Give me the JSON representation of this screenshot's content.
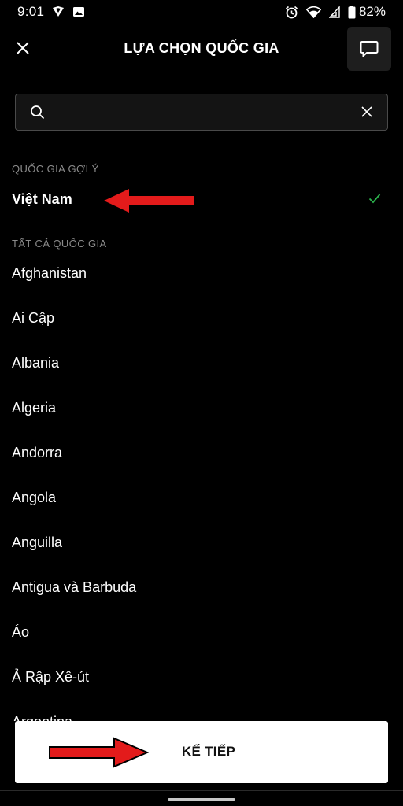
{
  "status_bar": {
    "time": "9:01",
    "battery": "82%",
    "left_icons": [
      "shield-icon",
      "image-icon"
    ],
    "right_icons": [
      "alarm-icon",
      "wifi-icon",
      "signal-icon",
      "battery-icon"
    ]
  },
  "header": {
    "title": "LỰA CHỌN QUỐC GIA",
    "close_icon": "close-icon",
    "chat_icon": "chat-bubble-icon"
  },
  "search": {
    "value": "",
    "placeholder": ""
  },
  "suggested": {
    "header": "QUỐC GIA GỢI Ý",
    "country": "Việt Nam",
    "selected": true
  },
  "all": {
    "header": "TẤT CẢ QUỐC GIA",
    "countries": [
      "Afghanistan",
      "Ai Cập",
      "Albania",
      "Algeria",
      "Andorra",
      "Angola",
      "Anguilla",
      "Antigua và Barbuda",
      "Áo",
      "Ả Rập Xê-út",
      "Argentina"
    ]
  },
  "footer": {
    "next_label": "KẾ TIẾP"
  },
  "colors": {
    "background": "#000000",
    "check": "#2bb24c",
    "annotation_arrow": "#e31b1b"
  }
}
